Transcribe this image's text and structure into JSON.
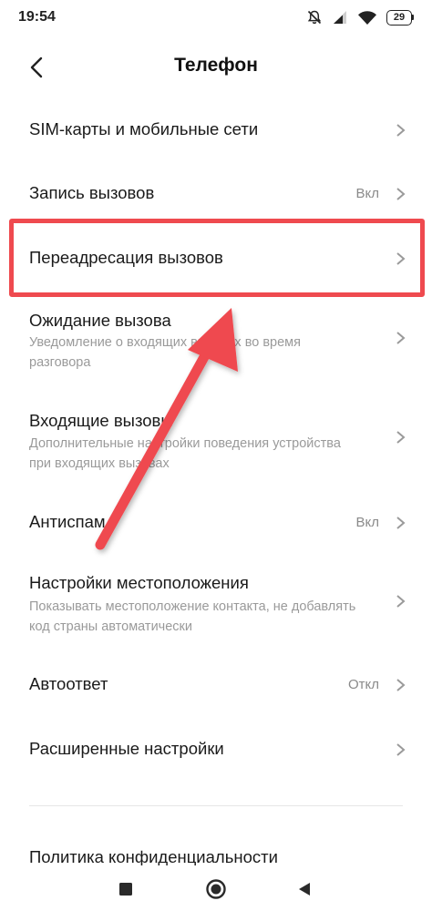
{
  "status_bar": {
    "time": "19:54",
    "icons": [
      "muted-bell-icon",
      "signal-icon",
      "wifi-icon",
      "battery-icon"
    ],
    "battery_level": "29"
  },
  "header": {
    "back_icon": "chevron-left-icon",
    "title": "Телефон"
  },
  "items": [
    {
      "title": "SIM-карты и мобильные сети"
    },
    {
      "title": "Запись вызовов",
      "value": "Вкл"
    },
    {
      "title": "Переадресация вызовов"
    },
    {
      "title": "Ожидание вызова",
      "description": "Уведомление о входящих вызовах во время разговора"
    },
    {
      "title": "Входящие вызовы",
      "description": "Дополнительные настройки поведения устройства при входящих вызовах"
    },
    {
      "title": "Антиспам",
      "value": "Вкл"
    },
    {
      "title": "Настройки местоположения",
      "description": "Показывать местоположение контакта, не добавлять код страны автоматически"
    },
    {
      "title": "Автоответ",
      "value": "Откл"
    },
    {
      "title": "Расширенные настройки"
    }
  ],
  "partial_item": "Политика конфиденциальности",
  "nav_bar": {
    "icons": [
      "square-icon",
      "home-circle-icon",
      "back-triangle-icon"
    ]
  },
  "annotation": {
    "color": "#ef4a4f",
    "highlighted_item": "Переадресация вызовов"
  }
}
